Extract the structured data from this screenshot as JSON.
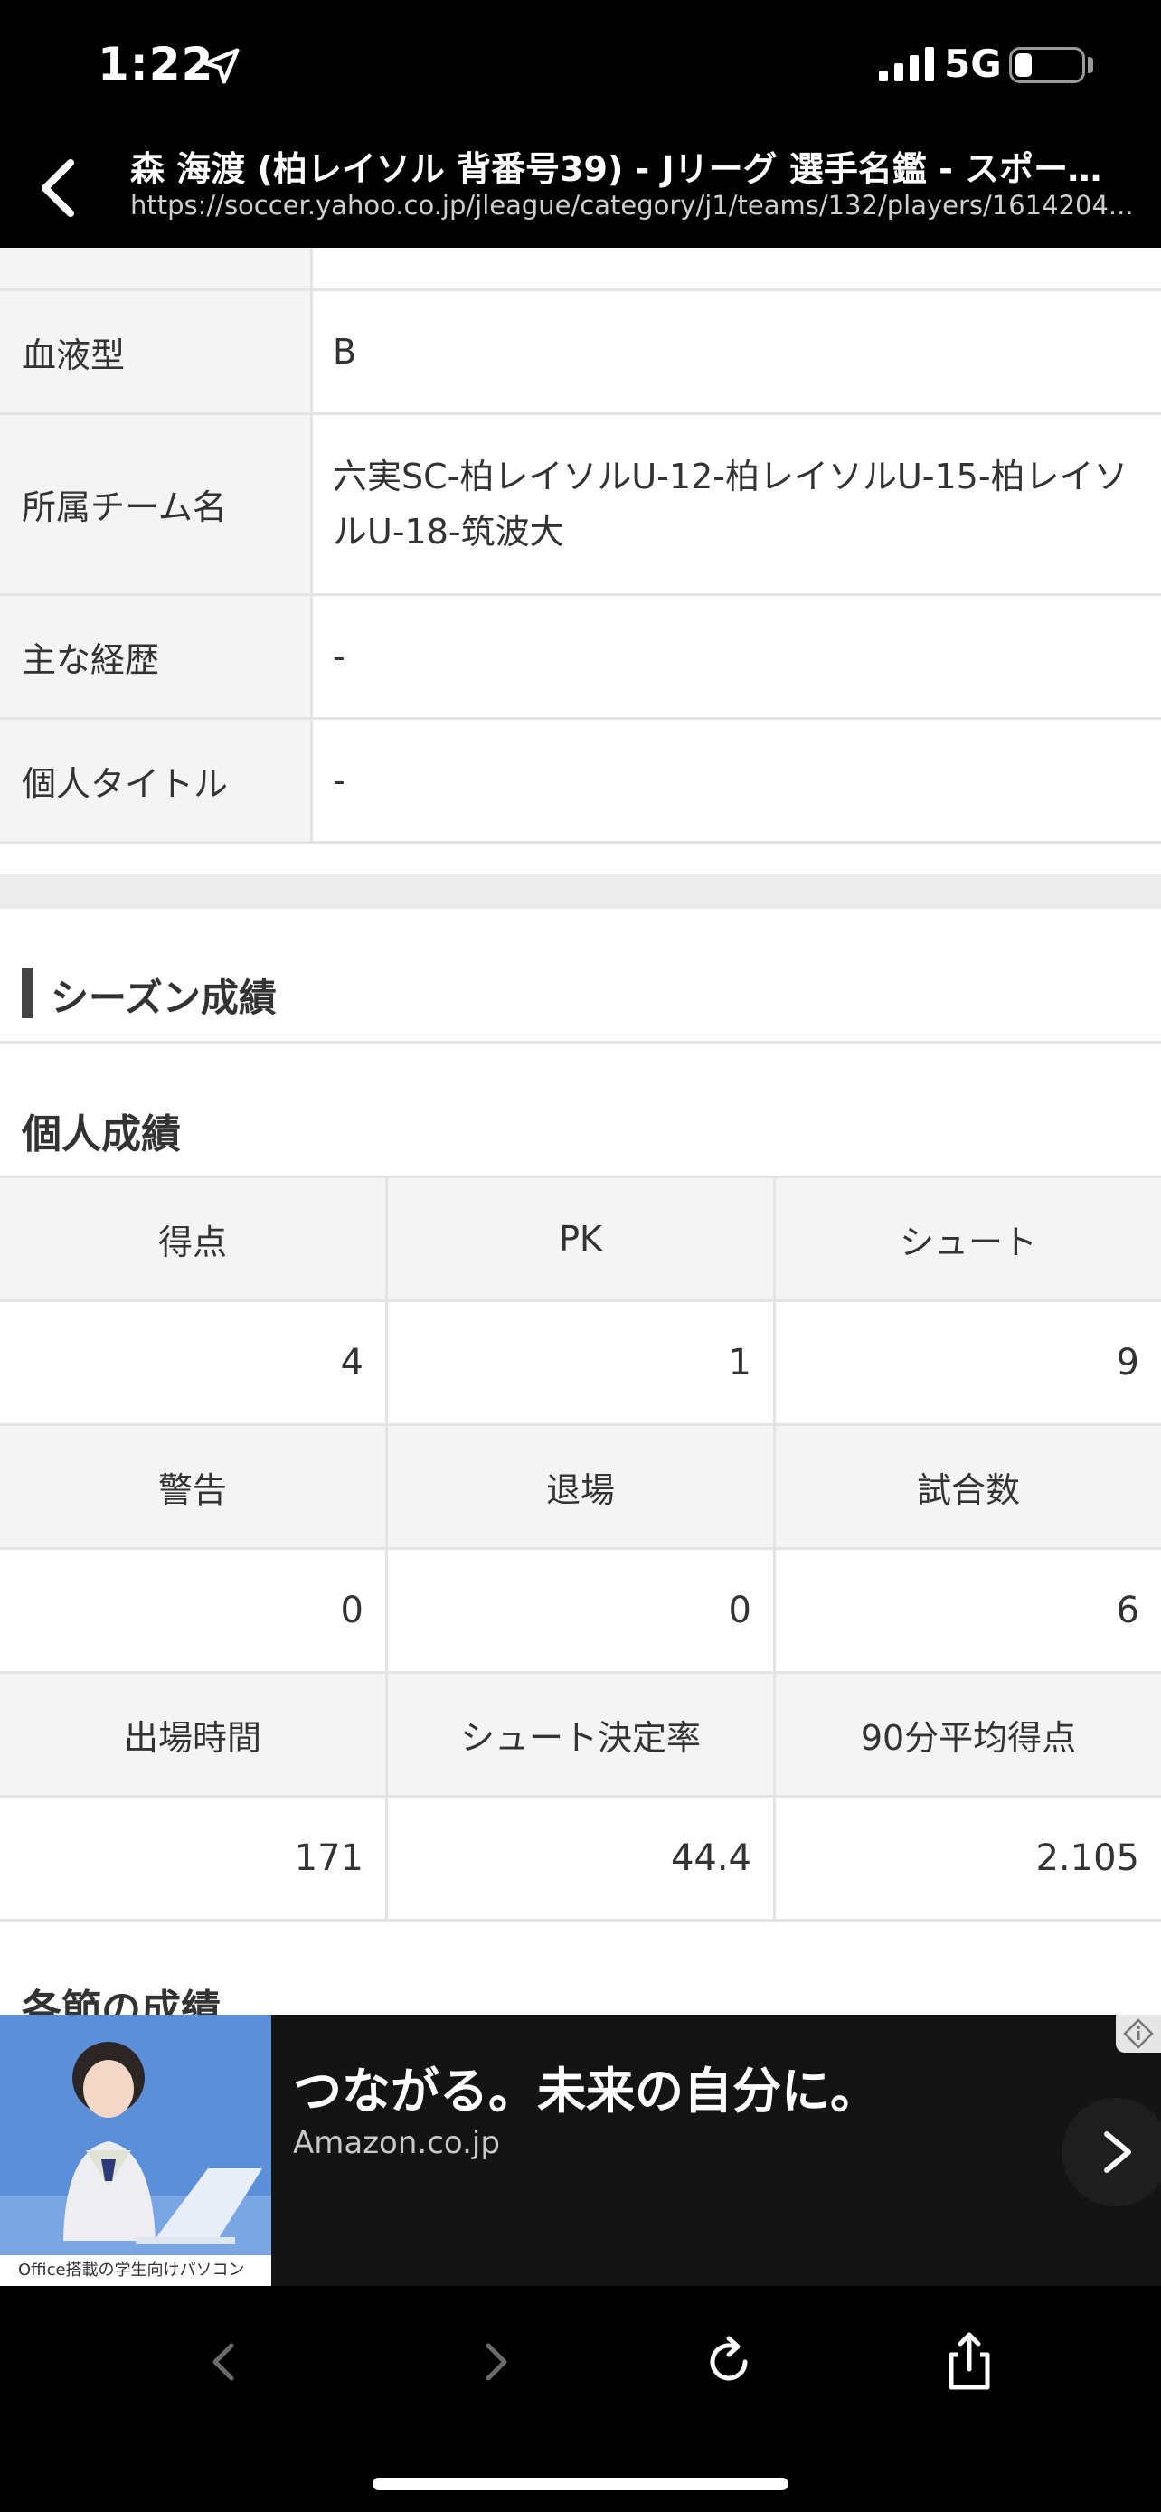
{
  "status": {
    "time": "1:22",
    "network": "5G"
  },
  "header": {
    "title": "森 海渡 (柏レイソル 背番号39) - Jリーグ 選手名鑑 - スポーツナビ",
    "url": "https://soccer.yahoo.co.jp/jleague/category/j1/teams/132/players/1614204..."
  },
  "profile": {
    "rows": [
      {
        "label": "血液型",
        "value": "B"
      },
      {
        "label": "所属チーム名",
        "value": "六実SC-柏レイソルU-12-柏レイソルU-15-柏レイソルU-18-筑波大"
      },
      {
        "label": "主な経歴",
        "value": "-"
      },
      {
        "label": "個人タイトル",
        "value": "-"
      }
    ]
  },
  "season": {
    "title": "シーズン成績",
    "personal_title": "個人成績",
    "rows": [
      {
        "headers": [
          "得点",
          "PK",
          "シュート"
        ],
        "values": [
          "4",
          "1",
          "9"
        ]
      },
      {
        "headers": [
          "警告",
          "退場",
          "試合数"
        ],
        "values": [
          "0",
          "0",
          "6"
        ]
      },
      {
        "headers": [
          "出場時間",
          "シュート決定率",
          "90分平均得点"
        ],
        "values": [
          "171",
          "44.4",
          "2.105"
        ]
      }
    ],
    "next_title": "各節の成績"
  },
  "ad": {
    "headline": "つながる。未来の自分に。",
    "source": "Amazon.co.jp",
    "image_caption": "Office搭載の学生向けパソコン"
  },
  "colors": {
    "accent_bar": "#444444",
    "header_bg": "#000000",
    "cell_header_bg": "#f4f4f4"
  }
}
